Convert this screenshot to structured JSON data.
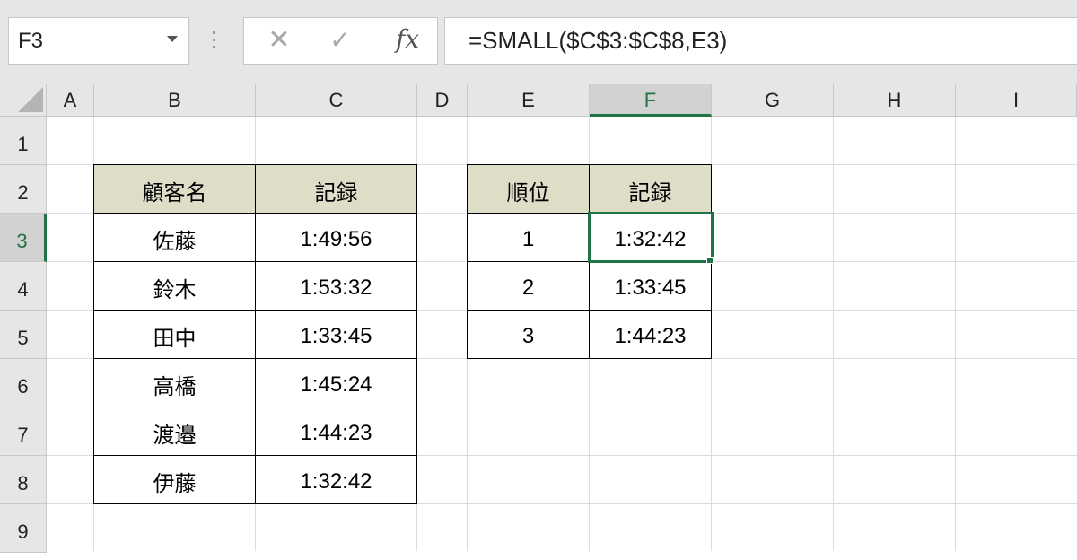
{
  "formula_bar": {
    "name_box": "F3",
    "cancel_glyph": "✕",
    "enter_glyph": "✓",
    "function_glyph": "fx",
    "formula": "=SMALL($C$3:$C$8,E3)"
  },
  "columns": [
    "A",
    "B",
    "C",
    "D",
    "E",
    "F",
    "G",
    "H",
    "I"
  ],
  "rows": [
    "1",
    "2",
    "3",
    "4",
    "5",
    "6",
    "7",
    "8",
    "9"
  ],
  "selected": {
    "column": "F",
    "row": "3"
  },
  "table1": {
    "headers": [
      "顧客名",
      "記録"
    ],
    "rows": [
      [
        "佐藤",
        "1:49:56"
      ],
      [
        "鈴木",
        "1:53:32"
      ],
      [
        "田中",
        "1:33:45"
      ],
      [
        "高橋",
        "1:45:24"
      ],
      [
        "渡邉",
        "1:44:23"
      ],
      [
        "伊藤",
        "1:32:42"
      ]
    ]
  },
  "table2": {
    "headers": [
      "順位",
      "記録"
    ],
    "rows": [
      [
        "1",
        "1:32:42"
      ],
      [
        "2",
        "1:33:45"
      ],
      [
        "3",
        "1:44:23"
      ]
    ]
  },
  "colors": {
    "header_fill": "#deddc8",
    "selection": "#217346"
  }
}
